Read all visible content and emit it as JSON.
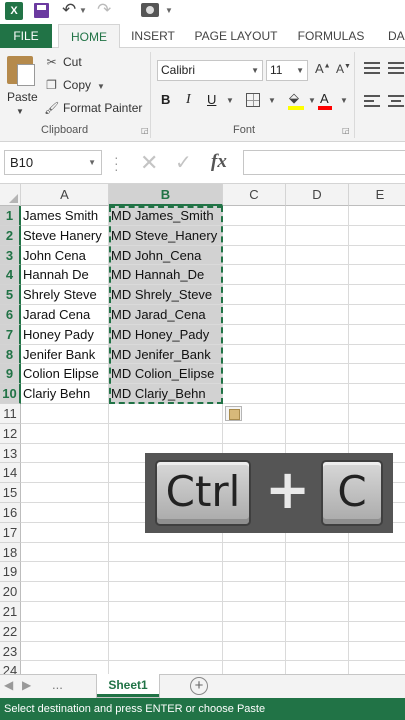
{
  "app": {
    "logo_letter": "X"
  },
  "ribbon_tabs": [
    "FILE",
    "HOME",
    "INSERT",
    "PAGE LAYOUT",
    "FORMULAS",
    "DA"
  ],
  "clipboard": {
    "paste_label": "Paste",
    "cut_label": "Cut",
    "copy_label": "Copy",
    "format_painter_label": "Format Painter",
    "group_label": "Clipboard"
  },
  "font": {
    "family": "Calibri",
    "size": "11",
    "bold": "B",
    "italic": "I",
    "underline": "U",
    "group_label": "Font"
  },
  "formula_bar": {
    "name_box": "B10",
    "fx": "fx",
    "content": ""
  },
  "grid": {
    "columns": [
      "A",
      "B",
      "C",
      "D",
      "E"
    ],
    "selected_column": "B",
    "rows": [
      "1",
      "2",
      "3",
      "4",
      "5",
      "6",
      "7",
      "8",
      "9",
      "10",
      "11",
      "12",
      "13",
      "14",
      "15",
      "16",
      "17",
      "18",
      "19",
      "20",
      "21",
      "22",
      "23",
      "24"
    ],
    "data": [
      {
        "a": "James Smith",
        "b": "MD James_Smith"
      },
      {
        "a": "Steve Hanery",
        "b": "MD Steve_Hanery"
      },
      {
        "a": "John Cena",
        "b": "MD John_Cena"
      },
      {
        "a": "Hannah De",
        "b": "MD Hannah_De"
      },
      {
        "a": "Shrely Steve",
        "b": "MD Shrely_Steve"
      },
      {
        "a": "Jarad Cena",
        "b": "MD Jarad_Cena"
      },
      {
        "a": "Honey Pady",
        "b": "MD Honey_Pady"
      },
      {
        "a": "Jenifer Bank",
        "b": "MD Jenifer_Bank"
      },
      {
        "a": "Colion Elipse",
        "b": "MD Colion_Elipse"
      },
      {
        "a": "Clariy Behn",
        "b": "MD Clariy_Behn"
      }
    ]
  },
  "keyboard_overlay": {
    "key1": "Ctrl",
    "plus": "+",
    "key2": "C"
  },
  "sheets": {
    "active": "Sheet1",
    "add_symbol": "+",
    "nav_dots": "..."
  },
  "status_bar": {
    "text": "Select destination and press ENTER or choose Paste"
  },
  "colors": {
    "excel_green": "#217346",
    "selection_gray": "#d2d2d2"
  }
}
